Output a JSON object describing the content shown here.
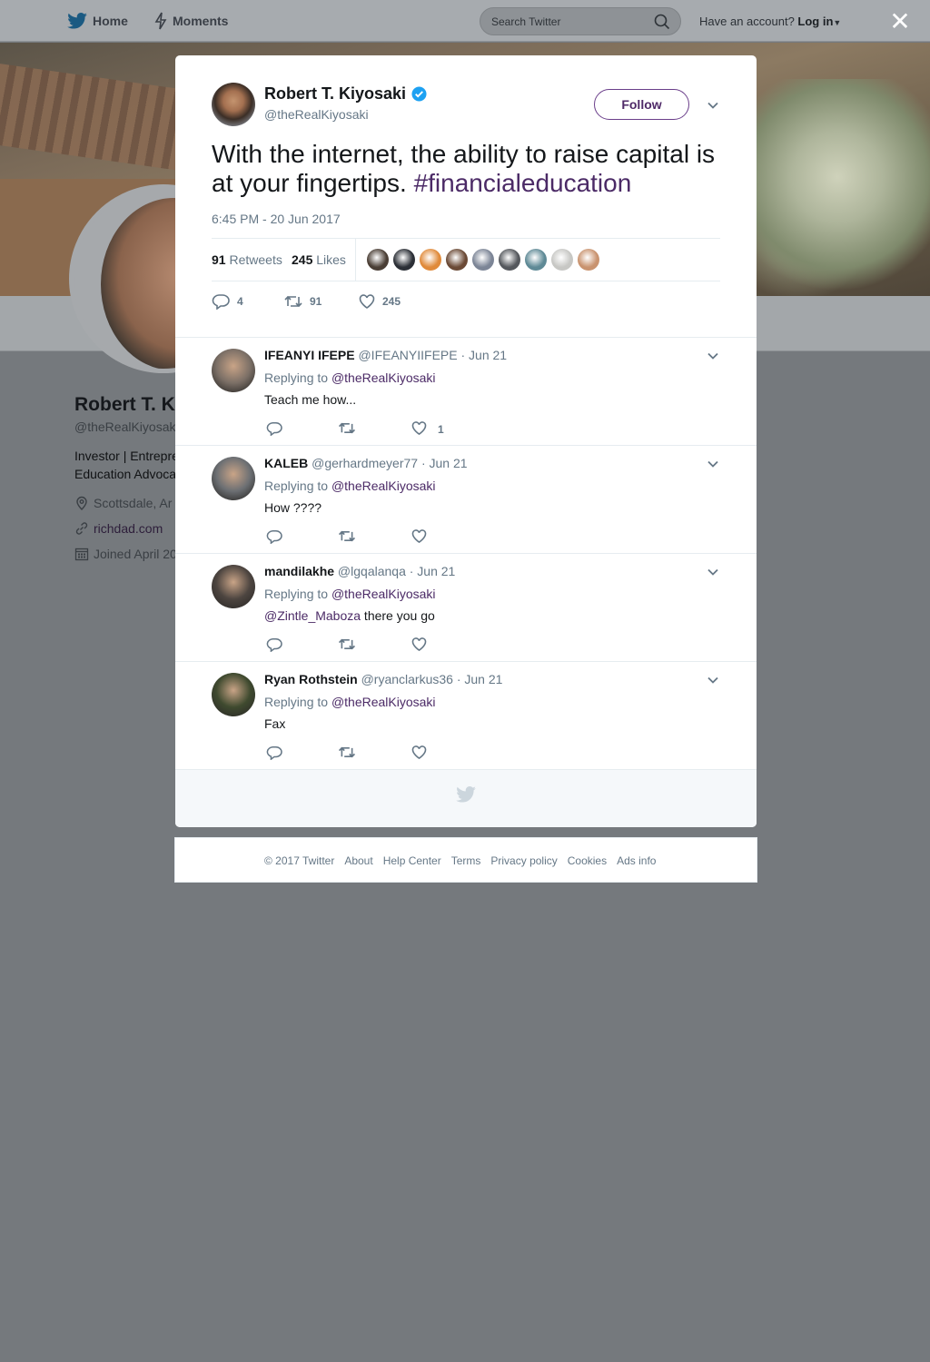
{
  "topnav": {
    "home_label": "Home",
    "moments_label": "Moments",
    "search_placeholder": "Search Twitter",
    "have_account": "Have an account?",
    "login_label": "Log in",
    "close_symbol": "✕"
  },
  "profile": {
    "name_partial": "Robert T. K",
    "handle_partial": "@theRealKiyosaki",
    "bio_line1": "Investor | Entrepre",
    "bio_line2": "Education Advoca",
    "location_partial": "Scottsdale, Ar",
    "website": "richdad.com",
    "joined_partial": "Joined April 20"
  },
  "tweet": {
    "name": "Robert T. Kiyosaki",
    "handle": "@theRealKiyosaki",
    "verified": true,
    "follow_label": "Follow",
    "text": "With the internet, the ability to raise capital is at your fingertips.",
    "hashtag": "#financialeducation",
    "timestamp": "6:45 PM - 20 Jun 2017",
    "retweets_count": "91",
    "retweets_label": "Retweets",
    "likes_count": "245",
    "likes_label": "Likes",
    "reply_count": "4",
    "retweet_count": "91",
    "like_count": "245"
  },
  "likers": [
    {
      "color": "#4a3e35"
    },
    {
      "color": "#2b2f36"
    },
    {
      "color": "#e08a3a"
    },
    {
      "color": "#6b4a36"
    },
    {
      "color": "#7c8596"
    },
    {
      "color": "#55585d"
    },
    {
      "color": "#5f8a96"
    },
    {
      "color": "#c7c7c4"
    },
    {
      "color": "#c9936f"
    }
  ],
  "replies": [
    {
      "name": "IFEANYI IFEPE",
      "handle": "@IFEANYIIFEPE",
      "date": "· Jun 21",
      "replying_prefix": "Replying to",
      "replying_to": "@theRealKiyosaki",
      "mention": "",
      "text": "Teach me how...",
      "like_count": "1",
      "avatar_color": "#7b6f66"
    },
    {
      "name": "KALEB",
      "handle": "@gerhardmeyer77",
      "date": "· Jun 21",
      "replying_prefix": "Replying to",
      "replying_to": "@theRealKiyosaki",
      "mention": "",
      "text": "How ????",
      "like_count": "",
      "avatar_color": "#6c6f73"
    },
    {
      "name": "mandilakhe",
      "handle": "@lgqalanqa",
      "date": "· Jun 21",
      "replying_prefix": "Replying to",
      "replying_to": "@theRealKiyosaki",
      "mention": "@Zintle_Maboza",
      "text": " there you go",
      "like_count": "",
      "avatar_color": "#4d4540"
    },
    {
      "name": "Ryan Rothstein",
      "handle": "@ryanclarkus36",
      "date": "· Jun 21",
      "replying_prefix": "Replying to",
      "replying_to": "@theRealKiyosaki",
      "mention": "",
      "text": "Fax",
      "like_count": "",
      "avatar_color": "#3f4a2f"
    }
  ],
  "footer": {
    "copyright": "© 2017 Twitter",
    "about": "About",
    "help": "Help Center",
    "terms": "Terms",
    "privacy": "Privacy policy",
    "cookies": "Cookies",
    "ads": "Ads info"
  },
  "colors": {
    "accent": "#4b2a66",
    "overlay": "#75797d",
    "twitter_blue": "#1da1f2"
  }
}
